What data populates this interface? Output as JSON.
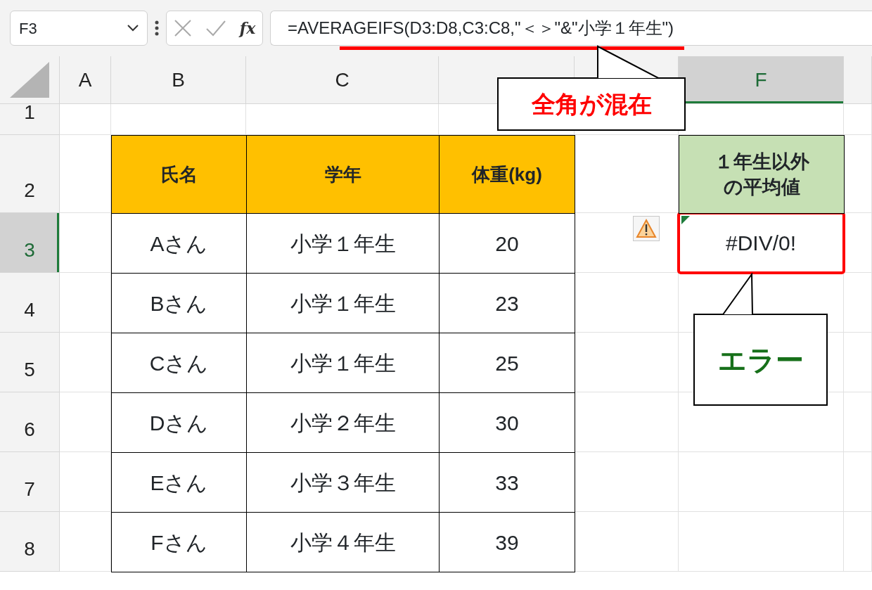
{
  "formula_bar": {
    "name_box": "F3",
    "function_label": "fx",
    "formula": "=AVERAGEIFS(D3:D8,C3:C8,\"＜＞\"&\"小学１年生\")"
  },
  "columns": [
    {
      "label": "A",
      "selected": false
    },
    {
      "label": "B",
      "selected": false
    },
    {
      "label": "C",
      "selected": false
    },
    {
      "selected": false
    },
    {
      "selected": false
    },
    {
      "label": "F",
      "selected": true
    }
  ],
  "rows": [
    {
      "label": "1",
      "selected": false
    },
    {
      "label": "2",
      "selected": false
    },
    {
      "label": "3",
      "selected": true
    },
    {
      "label": "4",
      "selected": false
    },
    {
      "label": "5",
      "selected": false
    },
    {
      "label": "6",
      "selected": false
    },
    {
      "label": "7",
      "selected": false
    },
    {
      "label": "8",
      "selected": false
    }
  ],
  "table": {
    "columns": [
      "氏名",
      "学年",
      "体重(kg)"
    ],
    "rows": [
      [
        "Aさん",
        "小学１年生",
        "20"
      ],
      [
        "Bさん",
        "小学１年生",
        "23"
      ],
      [
        "Cさん",
        "小学１年生",
        "25"
      ],
      [
        "Dさん",
        "小学２年生",
        "30"
      ],
      [
        "Eさん",
        "小学３年生",
        "33"
      ],
      [
        "Fさん",
        "小学４年生",
        "39"
      ]
    ]
  },
  "result": {
    "header_lines": [
      "１年生以外",
      "の平均値"
    ],
    "value": "#DIV/0!",
    "error": true
  },
  "callouts": [
    {
      "text": "全角が混在",
      "color": "#ff0000"
    },
    {
      "text": "エラー",
      "color": "#17701a"
    }
  ]
}
